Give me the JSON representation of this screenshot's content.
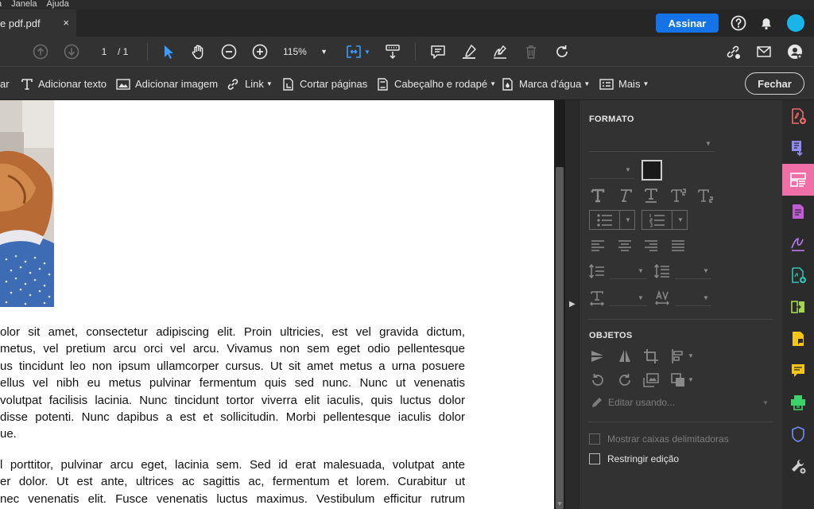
{
  "menubar": {
    "items": [
      "a",
      "Janela",
      "Ajuda"
    ]
  },
  "tabbar": {
    "tab_title": "e pdf.pdf",
    "close_glyph": "×",
    "sign_label": "Assinar"
  },
  "toolbar": {
    "page_current": "1",
    "page_total": "/ 1",
    "zoom": "115%"
  },
  "edit_toolbar": {
    "partial_first": "ar",
    "add_text": "Adicionar texto",
    "add_image": "Adicionar imagem",
    "link": "Link",
    "crop_pages": "Cortar páginas",
    "header_footer": "Cabeçalho e rodapé",
    "watermark": "Marca d'água",
    "more": "Mais",
    "close": "Fechar"
  },
  "document": {
    "paragraph1": [
      "olor sit amet, consectetur adipiscing elit. Proin ultricies, est vel gravida dictum,",
      " metus, vel pretium arcu orci vel arcu. Vivamus non sem eget odio pellentesque",
      "us tincidunt leo non ipsum ullamcorper cursus. Ut sit amet metus a urna posuere",
      "ellus vel nibh eu metus pulvinar fermentum quis sed nunc. Nunc ut venenatis",
      " volutpat facilisis lacinia. Nunc tincidunt tortor viverra elit iaculis, quis luctus dolor",
      "disse potenti. Nunc dapibus a est et sollicitudin. Morbi pellentesque iaculis dolor",
      "ue."
    ],
    "paragraph2": [
      "l porttitor, pulvinar arcu eget, lacinia sem. Sed id erat malesuada, volutpat ante",
      "er dolor. Ut est ante, ultrices ac sagittis ac, fermentum et lorem. Curabitur ut",
      "nec venenatis elit. Fusce venenatis luctus maximus. Vestibulum efficitur rutrum"
    ]
  },
  "panel": {
    "format_heading": "FORMATO",
    "objects_heading": "OBJETOS",
    "edit_using": "Editar usando...",
    "show_boxes": "Mostrar caixas delimitadoras",
    "restrict_edit": "Restringir edição"
  },
  "colors": {
    "accent": "#1473e6",
    "rail_active": "#f06fa6",
    "panel_bg": "#323232"
  }
}
